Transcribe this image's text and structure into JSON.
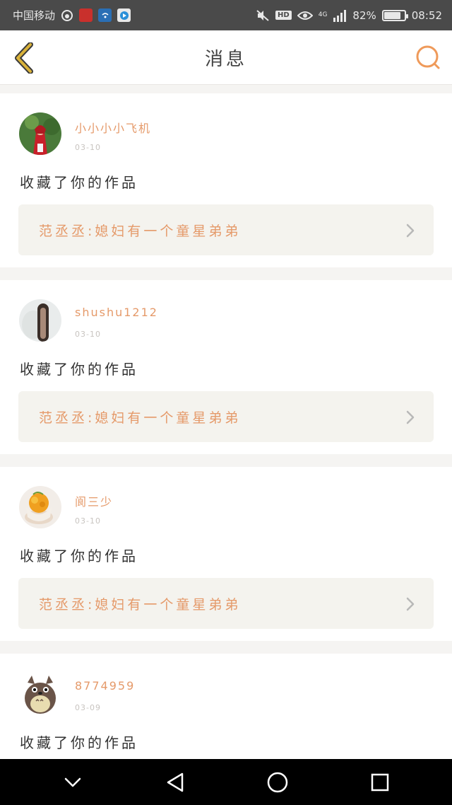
{
  "status_bar": {
    "carrier": "中国移动",
    "battery_percent": "82%",
    "battery_level": 0.82,
    "time": "08:52",
    "hd_label": "HD",
    "network_label": "4G"
  },
  "header": {
    "title": "消息"
  },
  "messages": [
    {
      "username": "小小小小飞机",
      "date": "03-10",
      "action": "收藏了你的作品",
      "work_title": "范丞丞:媳妇有一个童星弟弟"
    },
    {
      "username": "shushu1212",
      "date": "03-10",
      "action": "收藏了你的作品",
      "work_title": "范丞丞:媳妇有一个童星弟弟"
    },
    {
      "username": "阆三少",
      "date": "03-10",
      "action": "收藏了你的作品",
      "work_title": "范丞丞:媳妇有一个童星弟弟"
    },
    {
      "username": "8774959",
      "date": "03-09",
      "action": "收藏了你的作品"
    }
  ],
  "colors": {
    "accent": "#e59a6a",
    "back_icon": "#d4a017",
    "card_link_bg": "#f4f3ee"
  },
  "icons": {
    "back": "chevron-left-icon",
    "search": "search-icon",
    "work_arrow": "chevron-right-icon",
    "nav_down": "chevron-down-icon",
    "nav_back": "triangle-back-icon",
    "nav_home": "circle-home-icon",
    "nav_recent": "square-recent-icon"
  }
}
